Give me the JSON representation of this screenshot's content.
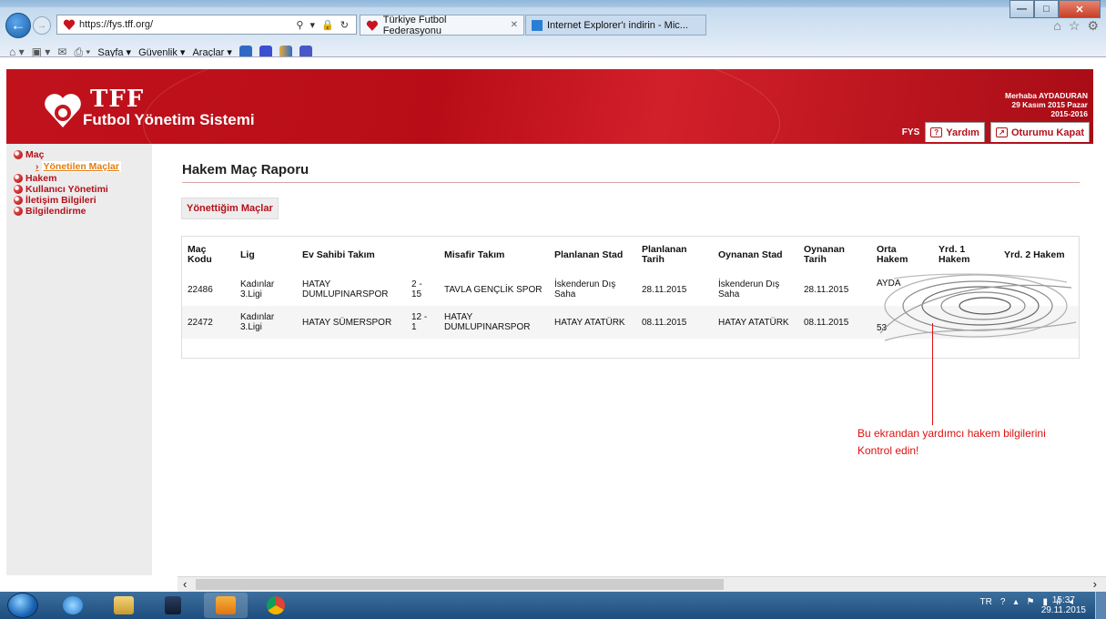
{
  "browser": {
    "url": "https://fys.tff.org/",
    "address_tools": "⚲ ▾ 🔒 ↻",
    "tabs": [
      {
        "label": "Türkiye Futbol Federasyonu",
        "active": true
      },
      {
        "label": "Internet Explorer'ı indirin - Mic...",
        "active": false
      }
    ],
    "command_bar": {
      "page": "Sayfa ▾",
      "security": "Güvenlik ▾",
      "tools": "Araçlar ▾"
    },
    "right_icons": [
      "home-icon",
      "star-icon",
      "gear-icon"
    ]
  },
  "header": {
    "brand": "TFF",
    "subtitle": "Futbol Yönetim Sistemi",
    "greeting": "Merhaba AYDADURAN",
    "date": "29 Kasım 2015 Pazar",
    "season": "2015-2016",
    "nav": {
      "fys": "FYS",
      "help": "Yardım",
      "logout": "Oturumu Kapat"
    }
  },
  "sidebar": {
    "items": [
      {
        "label": "Maç",
        "children": [
          {
            "label": "Yönetilen Maçlar",
            "active": true
          }
        ]
      },
      {
        "label": "Hakem"
      },
      {
        "label": "Kullanıcı Yönetimi"
      },
      {
        "label": "İletişim Bilgileri"
      },
      {
        "label": "Bilgilendirme"
      }
    ]
  },
  "main": {
    "title": "Hakem Maç Raporu",
    "tab": "Yönettiğim Maçlar",
    "table": {
      "columns": [
        "Maç Kodu",
        "Lig",
        "Ev Sahibi Takım",
        "",
        "Misafir Takım",
        "Planlanan Stad",
        "Planlanan Tarih",
        "Oynanan Stad",
        "Oynanan Tarih",
        "Orta Hakem",
        "Yrd. 1 Hakem",
        "Yrd. 2 Hakem"
      ],
      "rows": [
        [
          "22486",
          "Kadınlar 3.Ligi",
          "HATAY DUMLUPINARSPOR",
          "2 - 15",
          "TAVLA GENÇLİK SPOR",
          "İskenderun Dış Saha",
          "28.11.2015",
          "İskenderun Dış Saha",
          "28.11.2015",
          "AYDA",
          "",
          ""
        ],
        [
          "22472",
          "Kadınlar 3.Ligi",
          "HATAY SÜMERSPOR",
          "12 - 1",
          "HATAY DUMLUPINARSPOR",
          "HATAY ATATÜRK",
          "08.11.2015",
          "HATAY ATATÜRK",
          "08.11.2015",
          "53",
          "",
          ""
        ]
      ]
    }
  },
  "annotation": {
    "line1": "Bu ekrandan yardımcı hakem bilgilerini",
    "line2": "Kontrol edin!",
    "color": "#dd1111"
  },
  "taskbar": {
    "lang": "TR",
    "time": "15:37",
    "date": "29.11.2015",
    "apps": [
      "internet-explorer-icon",
      "file-explorer-icon",
      "media-player-icon",
      "outlook-icon",
      "chrome-icon"
    ]
  },
  "colors": {
    "brand_red": "#b3111b",
    "accent_orange": "#e37d11"
  }
}
